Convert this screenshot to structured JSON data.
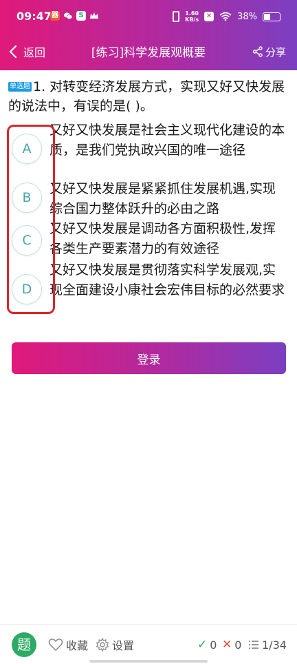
{
  "status_bar": {
    "time": "09:47",
    "net_speed_top": "1.60",
    "net_speed_bottom": "KB/s",
    "battery_text": "38%",
    "battery_level": 0.38,
    "app_icon_a": "器",
    "app_icon_c": "S"
  },
  "nav": {
    "back_label": "返回",
    "title": "[练习]科学发展观概要",
    "share_label": "分享"
  },
  "question": {
    "type_tag": "单选题",
    "text": "1. 对转变经济发展方式，实现又好又快发展的说法中，有误的是( )。"
  },
  "options": [
    {
      "letter": "A",
      "text": "又好又快发展是社会主义现代化建设的本质，是我们党执政兴国的唯一途径"
    },
    {
      "letter": "B",
      "text": "又好又快发展是紧紧抓住发展机遇,实现综合国力整体跃升的必由之路"
    },
    {
      "letter": "C",
      "text": "又好又快发展是调动各方面积极性,发挥各类生产要素潜力的有效途径"
    },
    {
      "letter": "D",
      "text": "又好又快发展是贯彻落实科学发展观,实现全面建设小康社会宏伟目标的必然要求"
    }
  ],
  "login_label": "登录",
  "bottom_bar": {
    "logo_char": "题",
    "favorite_label": "收藏",
    "settings_label": "设置",
    "correct_count": "0",
    "wrong_count": "0",
    "progress": "1/34"
  },
  "icons": {
    "back": "chevron-left-icon",
    "share": "share-icon",
    "favorite": "heart-icon",
    "settings": "gear-icon",
    "correct": "check-icon",
    "wrong": "cross-icon",
    "list": "list-icon"
  },
  "colors": {
    "header_gradient_start": "#e0197a",
    "header_gradient_end": "#7b3fc1",
    "option_circle": "#4aa3ab",
    "question_tag": "#1b9ce0",
    "highlight_box": "#d8262c",
    "correct": "#2eaa4a",
    "wrong": "#e04a3f"
  }
}
